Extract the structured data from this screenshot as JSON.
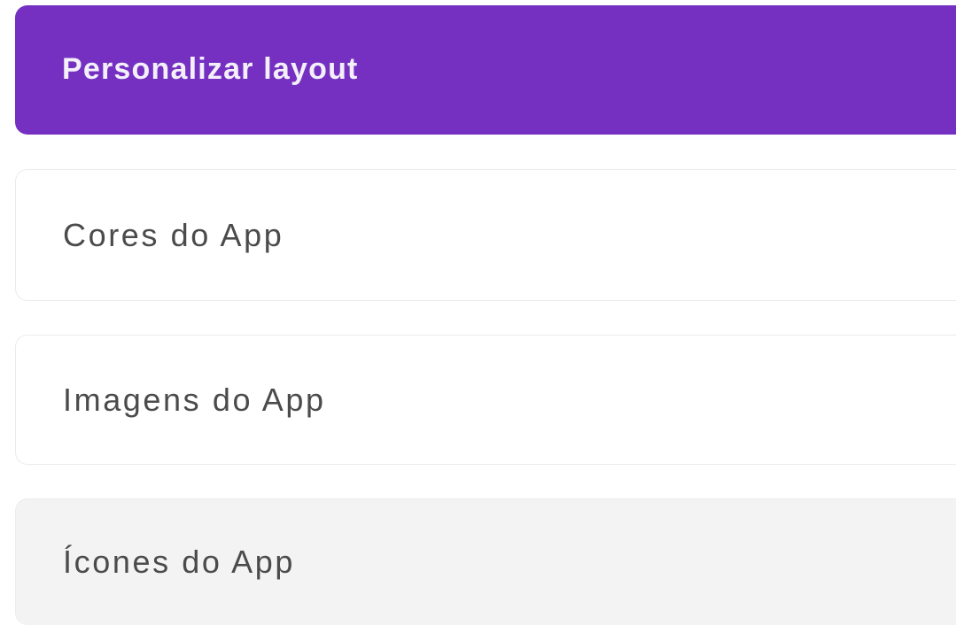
{
  "menu": {
    "header_label": "Personalizar layout",
    "items": [
      {
        "label": "Cores do App"
      },
      {
        "label": "Imagens do App"
      },
      {
        "label": "Ícones do App"
      }
    ]
  },
  "colors": {
    "accent": "#7530c2",
    "header_text": "#f4f0fa",
    "item_text": "#4b4b4b",
    "item_border": "#ebebeb",
    "hover_background": "#f3f3f3"
  }
}
